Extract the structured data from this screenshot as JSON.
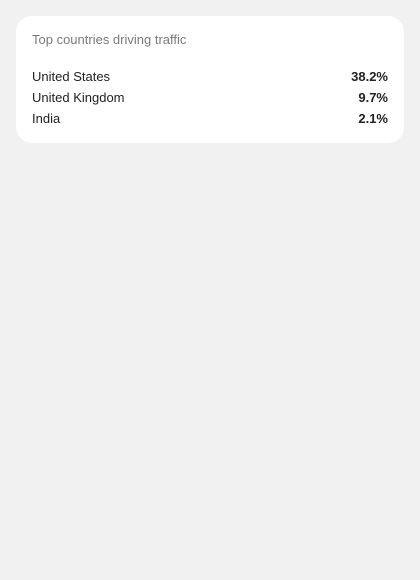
{
  "card": {
    "title": "Top countries driving traffic",
    "rows": [
      {
        "country": "United States",
        "percent": "38.2%"
      },
      {
        "country": "United Kingdom",
        "percent": "9.7%"
      },
      {
        "country": "India",
        "percent": "2.1%"
      }
    ]
  }
}
